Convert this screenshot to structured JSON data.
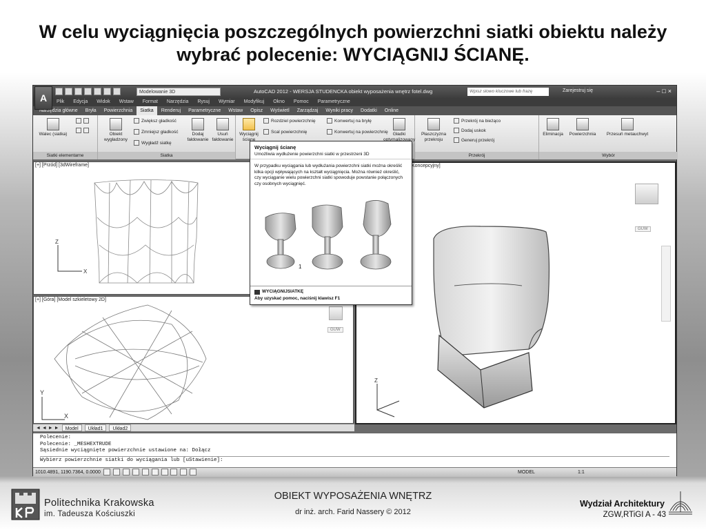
{
  "slide": {
    "title_line1": "W celu wyciągnięcia poszczególnych powierzchni siatki obiektu należy",
    "title_line2": "wybrać polecenie: WYCIĄGNIJ ŚCIANĘ."
  },
  "app": {
    "workspace": "Modelowanie 3D",
    "title": "AutoCAD 2012 - WERSJA STUDENCKA   obiekt wyposażenia wnętrz fotel.dwg",
    "search_placeholder": "Wpisz słowo kluczowe lub frazę",
    "login": "Zarejestruj się",
    "menu": [
      "Plik",
      "Edycja",
      "Widok",
      "Wstaw",
      "Format",
      "Narzędzia",
      "Rysuj",
      "Wymiar",
      "Modyfikuj",
      "Okno",
      "Pomoc",
      "Parametryczne"
    ],
    "tabs": [
      "Narzędzia główne",
      "Bryła",
      "Powierzchnia",
      "Siatka",
      "Renderuj",
      "Parametryczne",
      "Wstaw",
      "Opisz",
      "Wyświetl",
      "Zarządzaj",
      "Wyniki pracy",
      "Dodatki",
      "Online"
    ],
    "active_tab": "Siatka"
  },
  "ribbon": {
    "groups": {
      "primitives": "Siatki elementarne",
      "smooth": "Siatka",
      "section": "Przekrój",
      "selection": "Wybór"
    },
    "buttons": {
      "cylinder": "Walec (siatka)",
      "smooth_object": "Obiekt wygładzony",
      "smooth_more": "Zwiększ gładkość",
      "smooth_less": "Zmniejsz gładkość",
      "refine": "Wygładź siatkę",
      "add_crease": "Dodaj fałdowanie",
      "remove_crease": "Usuń fałdowanie",
      "extrude_face": "Wyciągnij ścianę",
      "split_face": "Rozdziel powierzchnię",
      "merge_face": "Scal powierzchnię",
      "convert_solid": "Konwertuj na bryłę",
      "convert_surface": "Konwertuj na powierzchnię",
      "smooth_optimized": "Gładki optymalizowany",
      "section_plane": "Płaszczyzna przekroju",
      "live_section": "Przekrój na bieżąco",
      "add_jog": "Dodaj uskok",
      "generate_section": "Generuj przekrój",
      "elimination": "Eliminacja",
      "surface_sel": "Powierzchnia",
      "gizmo": "Przesuń metauchwyt"
    }
  },
  "viewports": {
    "front": "[+] [Przód] [3dWireframe]",
    "top": "[+] [Góra] [Model szkieletowy 2D]",
    "persp": "Koncepcyjny]",
    "wcs": "GUW"
  },
  "tooltip": {
    "title": "Wyciągnij ścianę",
    "subtitle": "Umożliwia wydłużenie powierzchni siatki w przestrzeni 3D",
    "body": "W przypadku wyciągania lub wydłużania powierzchni siatki można określić kilka opcji wpływających na kształt wyciągnięcia. Można również określić, czy wyciąganie wielu powierzchni siatki spowoduje powstanie połączonych czy osobnych wyciągnięć.",
    "marker": "1",
    "command": "WYCIĄGNIJSIATKĘ",
    "help": "Aby uzyskać pomoc, naciśnij klawisz F1"
  },
  "layout_tabs": [
    "Model",
    "Układ1",
    "Układ2"
  ],
  "command_line": {
    "lines": [
      "Polecenie:",
      "Polecenie: _MESHEXTRUDE",
      "Sąsiednie wyciągnięte powierzchnie ustawione na: Dołącz"
    ],
    "prompt": "Wybierz powierzchnie siatki do wyciągania lub [uStawienie]:"
  },
  "status": {
    "coords": "1010.4891, 1190.7364, 0.0000",
    "model": "MODEL",
    "scale": "1:1"
  },
  "footer": {
    "university": "Politechnika Krakowska",
    "university_sub": "im. Tadeusza Kościuszki",
    "course": "OBIEKT WYPOSAŻENIA WNĘTRZ",
    "author": "dr inż. arch. Farid Nassery © 2012",
    "faculty": "Wydział Architektury",
    "slide_no": "ZGW,RTiGI A - 43"
  }
}
